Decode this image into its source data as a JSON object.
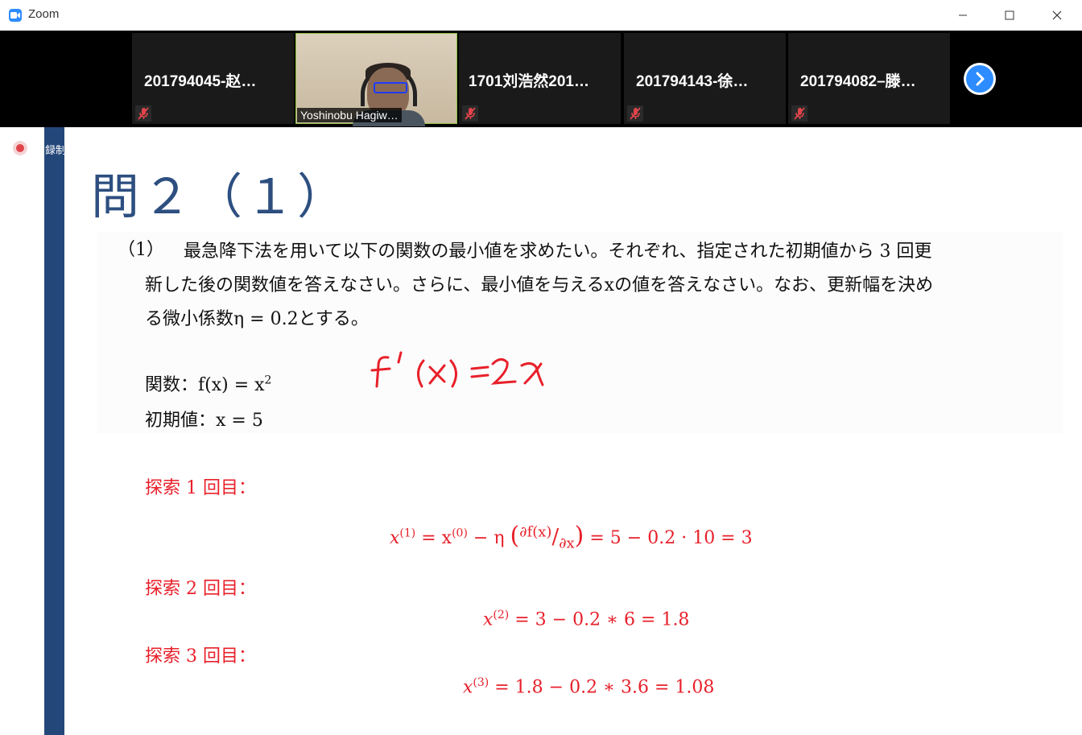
{
  "window": {
    "app_title": "Zoom"
  },
  "strip": {
    "participants": [
      {
        "name": "201794045-赵…",
        "muted": true
      },
      {
        "name": "Yoshinobu Hagiw…",
        "muted": false,
        "video": true
      },
      {
        "name": "1701刘浩然201…",
        "muted": true
      },
      {
        "name": "201794143-徐…",
        "muted": true
      },
      {
        "name": "201794082–滕…",
        "muted": true
      }
    ]
  },
  "recording": {
    "label": "録制"
  },
  "slide": {
    "title": "問２（１）",
    "problem_number": "（1）",
    "problem_text_line1": "最急降下法を用いて以下の関数の最小値を求めたい。それぞれ、指定された初期値から 3 回更",
    "problem_text_line2": "新した後の関数値を答えなさい。さらに、最小値を与えるxの値を答えなさい。なお、更新幅を決め",
    "problem_text_line3": "る微小係数η = 0.2とする。",
    "function_label": "関数：f(x) = x",
    "function_exp": "2",
    "initial_label": "初期値：x = 5",
    "handwriting": "f'(x)=2x",
    "steps": [
      {
        "label": "探索 1 回目：",
        "formula_lhs": "x",
        "formula_sup": "(1)",
        "formula_rest": " = x",
        "formula_sup2": "(0)",
        "formula_tail": " − η",
        "formula_frac_num": "∂f(x)",
        "formula_frac_den": "∂x",
        "formula_end": " = 5 − 0.2 · 10 = 3"
      },
      {
        "label": "探索 2 回目：",
        "formula_lhs": "x",
        "formula_sup": "(2)",
        "formula_rest": " = 3 − 0.2 ∗ 6 = 1.8"
      },
      {
        "label": "探索 3 回目：",
        "formula_lhs": "x",
        "formula_sup": "(3)",
        "formula_rest": " = 1.8 − 0.2 ∗ 3.6 = 1.08"
      }
    ]
  },
  "colors": {
    "accent_blue": "#2d8cff",
    "slide_bar": "#24477a",
    "title_blue": "#2d4f80",
    "red": "#e8202a"
  }
}
